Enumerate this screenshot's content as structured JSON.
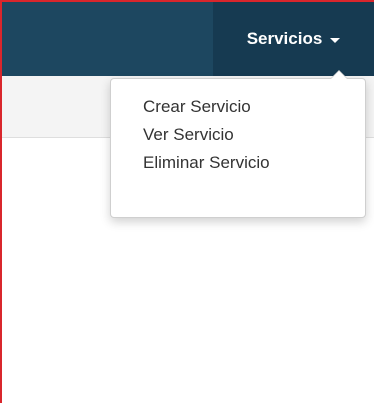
{
  "navbar": {
    "active_menu": "Servicios"
  },
  "dropdown": {
    "items": [
      {
        "label": "Crear Servicio"
      },
      {
        "label": "Ver Servicio"
      },
      {
        "label": "Eliminar Servicio"
      }
    ]
  },
  "colors": {
    "navbar_bg": "#1d4760",
    "navbar_active_bg": "#163a51",
    "subbar_bg": "#f4f4f4",
    "frame_border": "#d9262c"
  },
  "icons": {
    "dropdown_caret": "caret-down-icon"
  }
}
